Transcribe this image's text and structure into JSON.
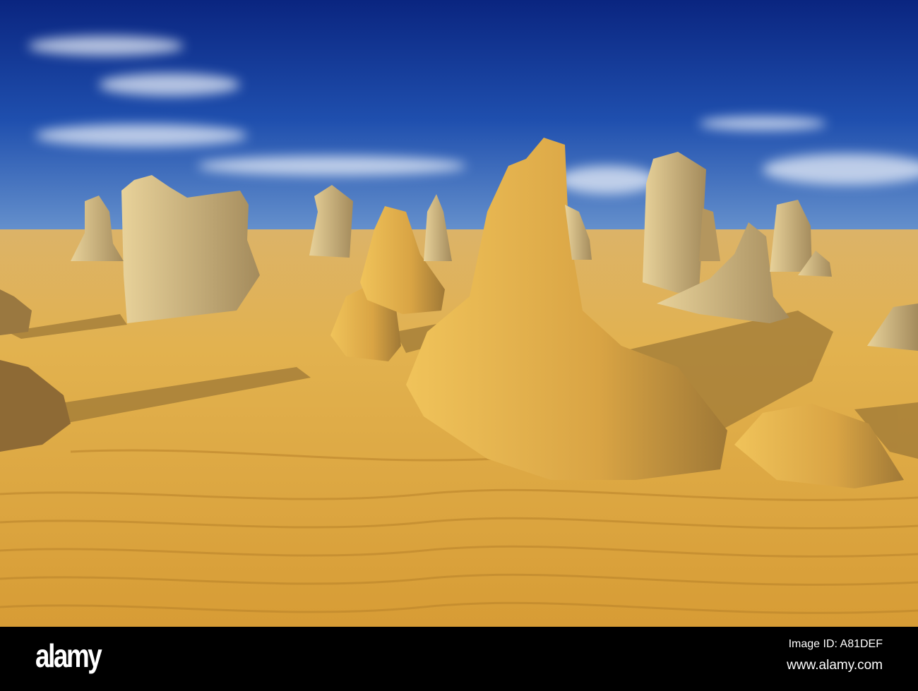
{
  "photo": {
    "sky_top": "#0b2a86",
    "sky_horizon": "#5f8fcf",
    "sand_light": "#e6b552",
    "sand_dark": "#c98f2a",
    "rock": "#d9a84a",
    "shadow": "#8d6a2c"
  },
  "footer": {
    "logo": "alamy",
    "image_id": "Image ID: A81DEF",
    "url": "www.alamy.com"
  }
}
